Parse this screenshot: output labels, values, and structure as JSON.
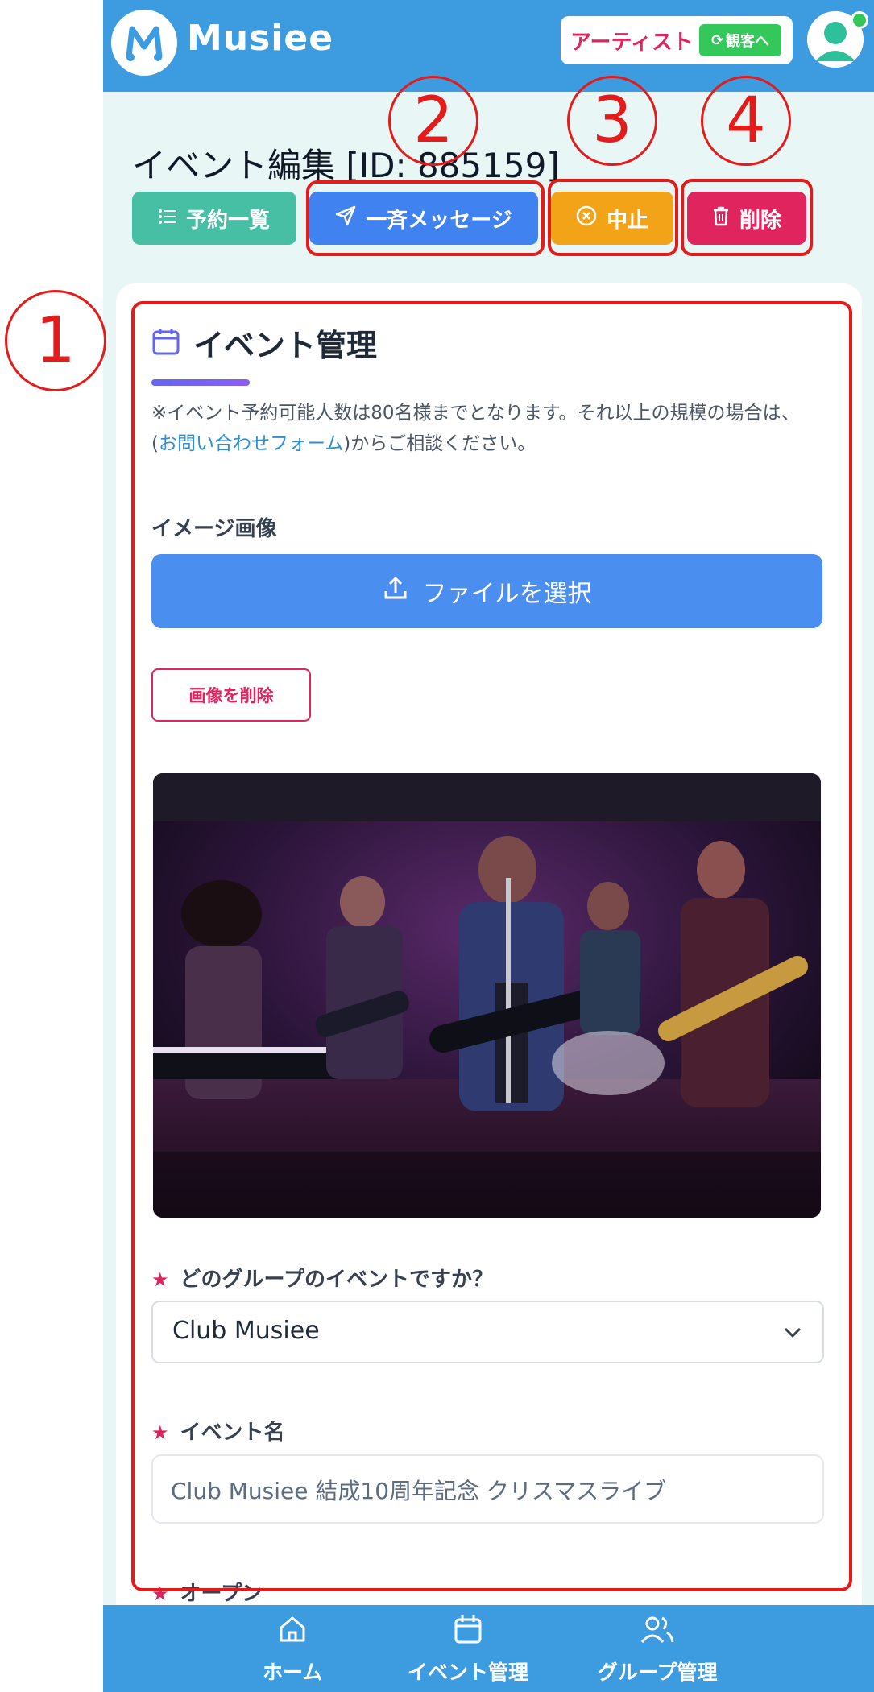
{
  "header": {
    "logo_text": "Musiee",
    "role_label": "アーティスト",
    "switch_label": "観客へ"
  },
  "page": {
    "title": "イベント編集 [ID: 885159]"
  },
  "actions": {
    "reservations_label": "予約一覧",
    "broadcast_label": "一斉メッセージ",
    "cancel_label": "中止",
    "delete_label": "削除"
  },
  "section": {
    "title": "イベント管理",
    "notice_prefix": "※イベント予約可能人数は80名様までとなります。それ以上の規模の場合は、(",
    "notice_link": "お問い合わせフォーム",
    "notice_suffix": ")からご相談ください。"
  },
  "image_field": {
    "label": "イメージ画像",
    "upload_label": "ファイルを選択",
    "remove_label": "画像を削除"
  },
  "group_field": {
    "label": "どのグループのイベントですか？",
    "value": "Club Musiee"
  },
  "name_field": {
    "label": "イベント名",
    "value": "Club Musiee 結成10周年記念 クリスマスライブ"
  },
  "open_field": {
    "label": "オープン"
  },
  "annotations": [
    "1",
    "2",
    "3",
    "4"
  ],
  "bottom_nav": {
    "home": "ホーム",
    "events": "イベント管理",
    "groups": "グループ管理"
  },
  "colors": {
    "header": "#3d9be0",
    "accent_red": "#e0245e",
    "annotation": "#e41b1b"
  }
}
